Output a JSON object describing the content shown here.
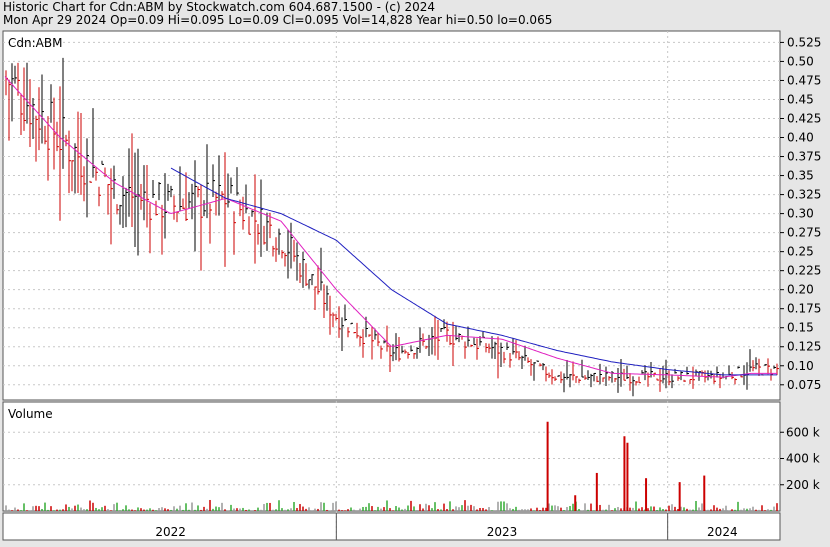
{
  "header": {
    "line1": "Historic Chart for Cdn:ABM by Stockwatch.com 604.687.1500 - (c) 2024",
    "line2": "Mon Apr 29 2024  Op=0.09  Hi=0.095  Lo=0.09  Cl=0.095  Vol=14,828  Year hi=0.50  lo=0.065"
  },
  "colors": {
    "background": "#e6e6e6",
    "panel": "#ffffff",
    "grid": "#c8c8c8",
    "up_bar": "#000000",
    "down_bar": "#cc0000",
    "ma_short": "#e020c0",
    "ma_long": "#2020c0",
    "vol_up": "#33aa33",
    "vol_down": "#cc0000",
    "vol_flat": "#999999"
  },
  "chart_data": [
    {
      "type": "line",
      "panel": "price",
      "title": "Cdn:ABM",
      "y_ticks": [
        "0.525",
        "0.50",
        "0.475",
        "0.45",
        "0.425",
        "0.40",
        "0.375",
        "0.35",
        "0.325",
        "0.30",
        "0.275",
        "0.25",
        "0.225",
        "0.20",
        "0.175",
        "0.15",
        "0.125",
        "0.10",
        "0.075"
      ],
      "ylim": [
        0.055,
        0.54
      ],
      "x": [
        "2022-01",
        "2022-03",
        "2022-05",
        "2022-07",
        "2022-09",
        "2022-11",
        "2023-01",
        "2023-03",
        "2023-05",
        "2023-07",
        "2023-09",
        "2023-11",
        "2024-01",
        "2024-03",
        "2024-04"
      ],
      "series": [
        {
          "values": [
            0.48,
            0.4,
            0.33,
            0.31,
            0.32,
            0.27,
            0.165,
            0.115,
            0.14,
            0.12,
            0.085,
            0.085,
            0.085,
            0.085,
            0.095
          ]
        },
        {
          "values": [
            0.48,
            0.4,
            0.34,
            0.3,
            0.32,
            0.29,
            0.2,
            0.125,
            0.14,
            0.135,
            0.11,
            0.09,
            0.088,
            0.085,
            0.09
          ]
        },
        {
          "values": [
            null,
            null,
            null,
            0.36,
            0.32,
            0.3,
            0.265,
            0.2,
            0.155,
            0.14,
            0.12,
            0.105,
            0.095,
            0.088,
            0.088
          ]
        }
      ]
    },
    {
      "type": "bar",
      "panel": "volume",
      "title": "Volume",
      "y_ticks": [
        "600 k",
        "400 k",
        "200 k"
      ],
      "ylim": [
        0,
        800000
      ],
      "spikes": [
        {
          "x": "2023-08",
          "value": 680000
        },
        {
          "x": "2023-11",
          "value": 570000
        },
        {
          "x": "2023-11",
          "value": 520000
        },
        {
          "x": "2023-10",
          "value": 290000
        },
        {
          "x": "2023-12",
          "value": 250000
        },
        {
          "x": "2024-02",
          "value": 270000
        },
        {
          "x": "2024-01",
          "value": 220000
        },
        {
          "x": "2023-09",
          "value": 120000
        }
      ]
    }
  ],
  "x_axis": {
    "labels": [
      "2022",
      "2023",
      "2024"
    ]
  }
}
